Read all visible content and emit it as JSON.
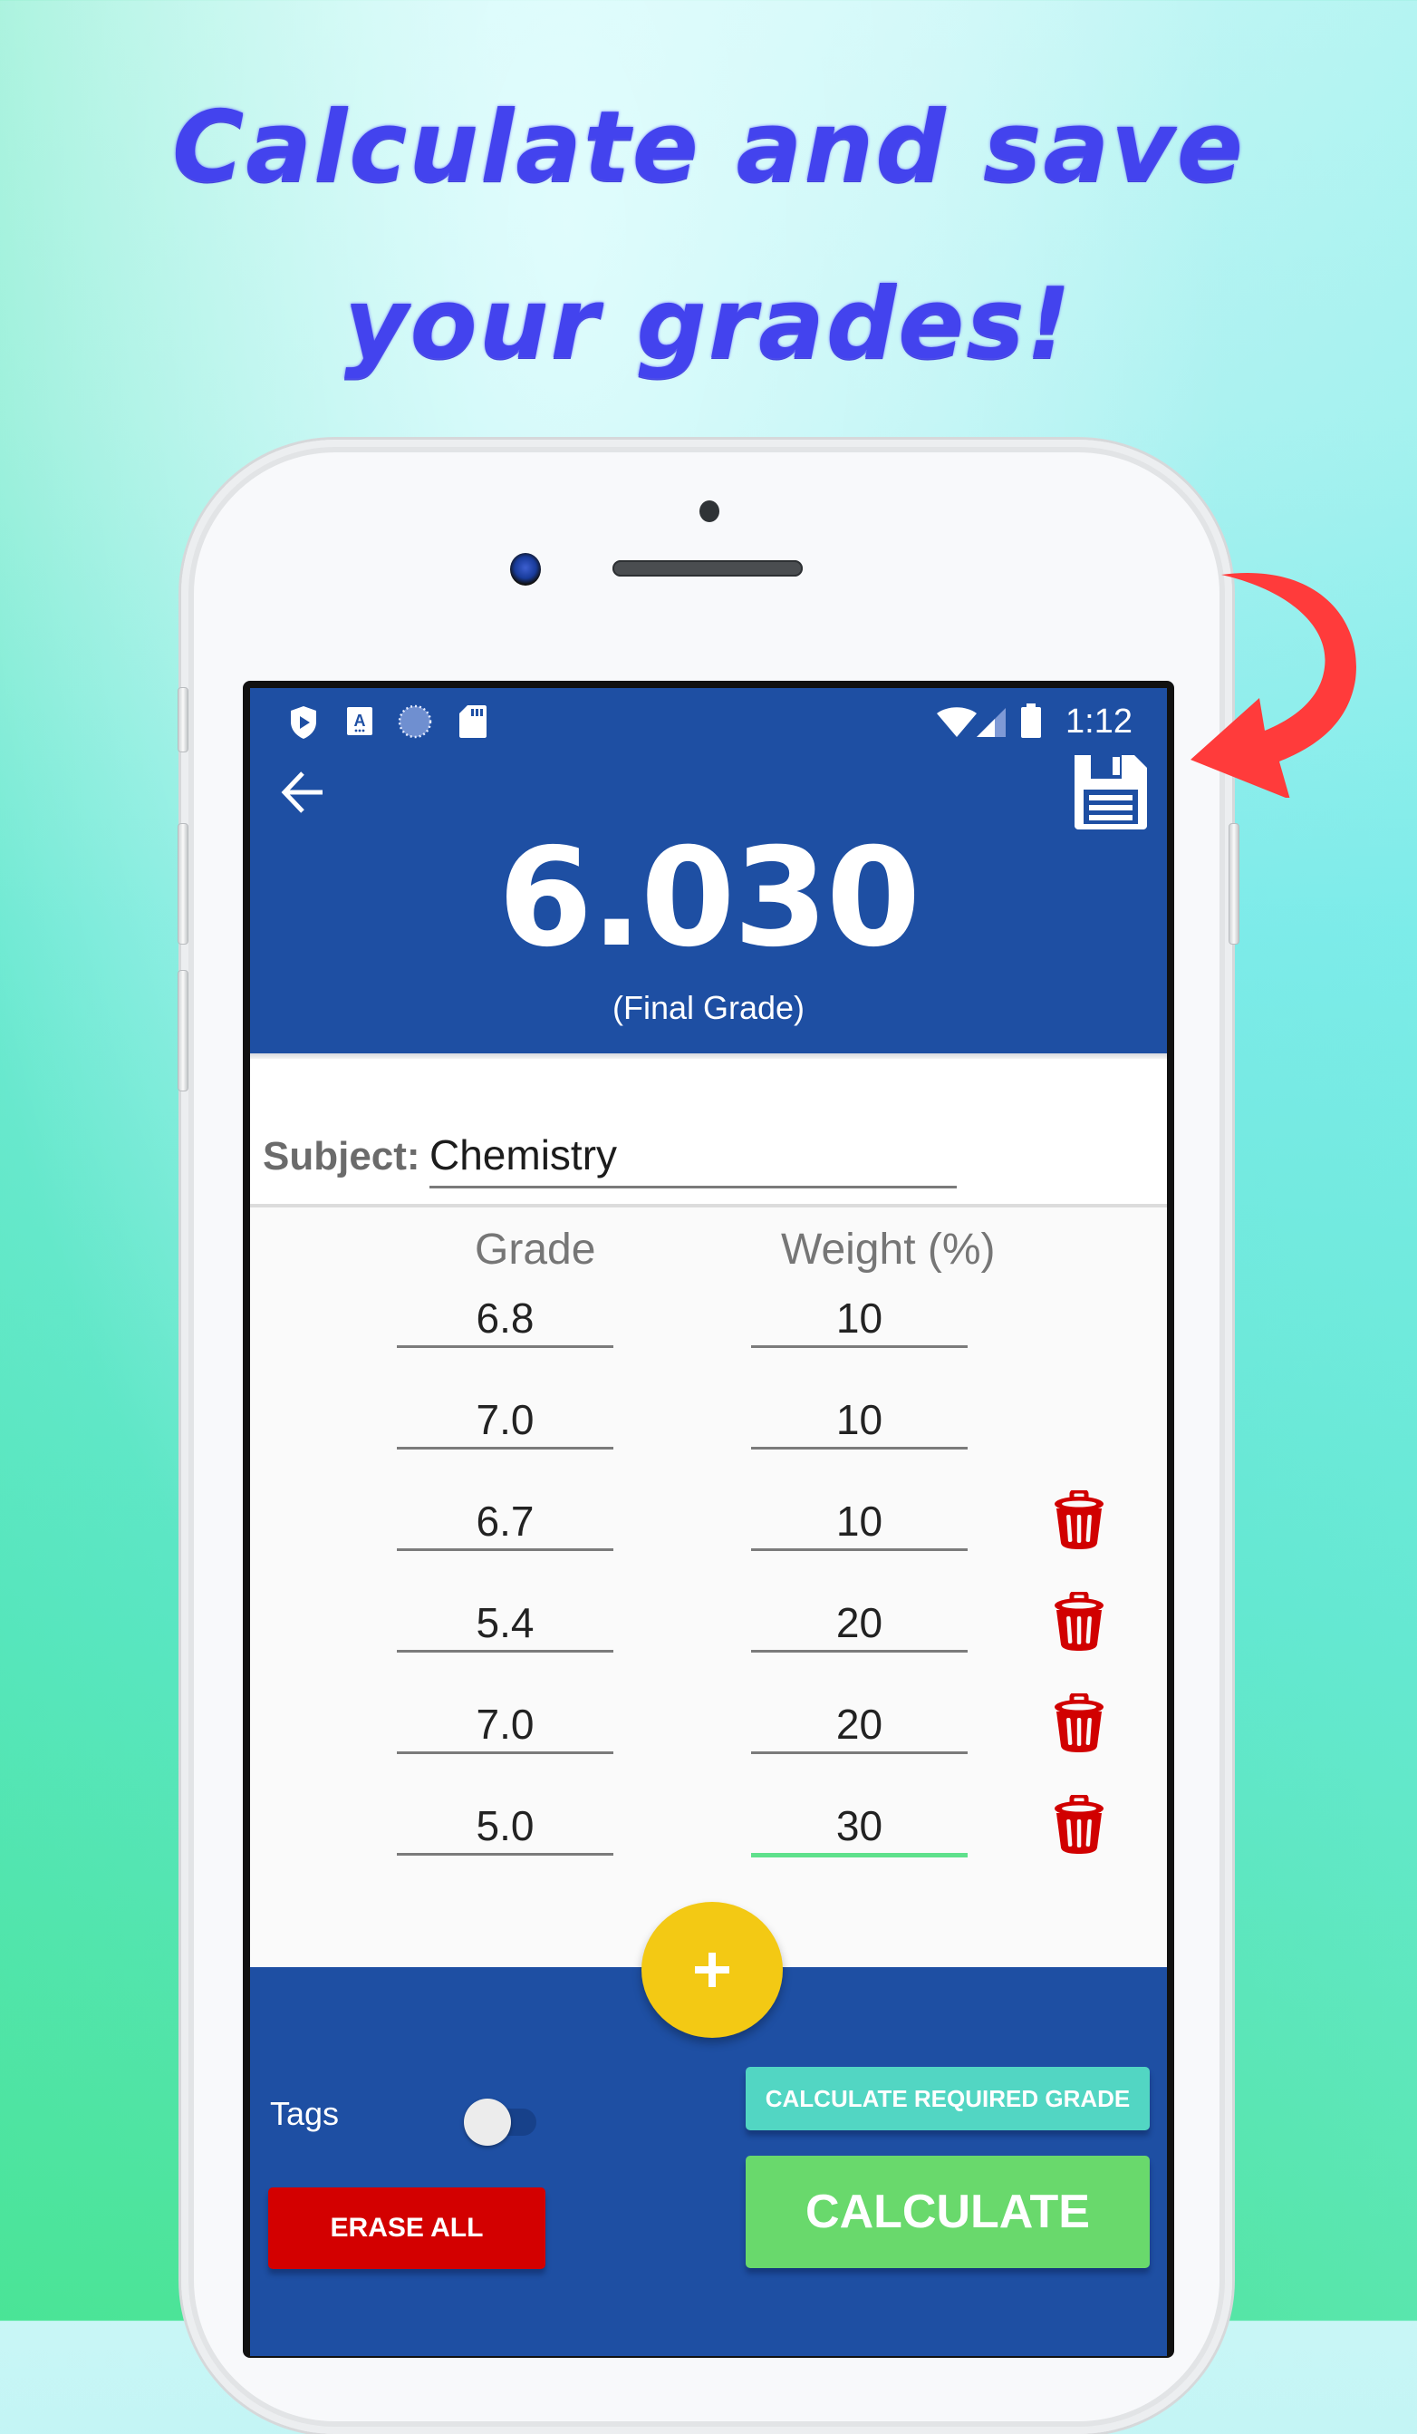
{
  "promo": {
    "headline_line1": "Calculate and save",
    "headline_line2": "your grades!",
    "headline_color": "#4343ee",
    "arrow_color": "#ff3b3b"
  },
  "status_bar": {
    "left_icons": [
      "play-protect-shield-icon",
      "keyboard-a-icon",
      "sync-progress-icon",
      "sd-card-icon"
    ],
    "right_icons": [
      "wifi-icon",
      "cell-signal-icon",
      "battery-icon"
    ],
    "time": "1:12"
  },
  "header": {
    "back_icon": "arrow-left-icon",
    "save_icon": "floppy-disk-icon",
    "final_grade": "6.030",
    "final_grade_label": "(Final Grade)",
    "background_color": "#1e4fa3"
  },
  "subject": {
    "label": "Subject:",
    "value": "Chemistry"
  },
  "table": {
    "columns": [
      "Grade",
      "Weight (%)"
    ],
    "rows": [
      {
        "grade": "6.8",
        "weight": "10",
        "deletable": false
      },
      {
        "grade": "7.0",
        "weight": "10",
        "deletable": false
      },
      {
        "grade": "6.7",
        "weight": "10",
        "deletable": true
      },
      {
        "grade": "5.4",
        "weight": "20",
        "deletable": true
      },
      {
        "grade": "7.0",
        "weight": "20",
        "deletable": true
      },
      {
        "grade": "5.0",
        "weight": "30",
        "deletable": true,
        "focused": true
      }
    ]
  },
  "fab": {
    "icon": "plus-icon",
    "color": "#f3c914"
  },
  "footer": {
    "tags_label": "Tags",
    "tags_toggle_on": false,
    "calc_required_label": "CALCULATE REQUIRED GRADE",
    "calculate_label": "CALCULATE",
    "erase_all_label": "ERASE ALL",
    "colors": {
      "calc_required": "#52d6c3",
      "calculate": "#69d96c",
      "erase_all": "#d30000"
    }
  }
}
